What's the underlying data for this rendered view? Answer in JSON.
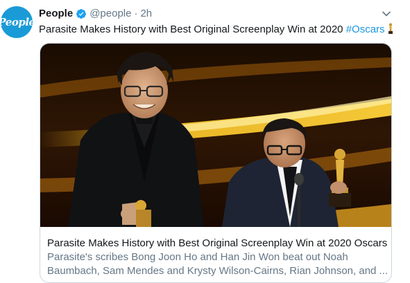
{
  "account": {
    "name": "People",
    "avatar_text": "People",
    "handle": "@people",
    "separator": "·",
    "time": "2h"
  },
  "tweet": {
    "text": "Parasite Makes History with Best Original Screenplay Win at 2020 ",
    "hashtag": "#Oscars"
  },
  "card": {
    "title": "Parasite Makes History with Best Original Screenplay Win at 2020 Oscars",
    "description_line1": "Parasite's scribes Bong Joon Ho and Han Jin Won beat out Noah",
    "description_line2": "Baumbach, Sam Mendes and Krysty Wilson-Cairns, Rian Johnson, and ..."
  },
  "icons": {
    "verified": "verified-badge-icon",
    "menu": "chevron-down-icon",
    "emoji": "trophy-emoji-icon"
  },
  "colors": {
    "brand_blue": "#1da1f2",
    "hashtag": "#1b95e0",
    "secondary_text": "#657786",
    "avatar_bg": "#1a9bd7"
  }
}
